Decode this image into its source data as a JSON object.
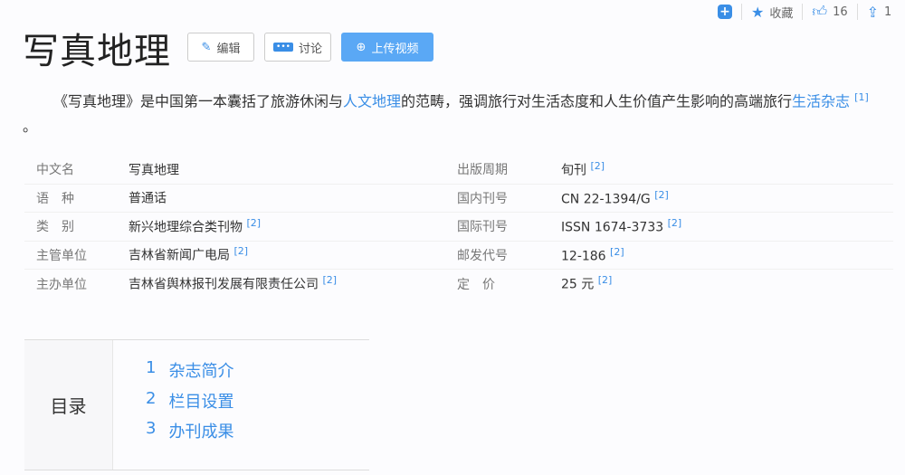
{
  "toolbar": {
    "collect": "收藏",
    "likes": "16",
    "share_count": "1"
  },
  "title": "写真地理",
  "buttons": {
    "edit": "编辑",
    "discuss": "讨论",
    "upload": "上传视频"
  },
  "intro": {
    "p1": "《写真地理》是中国第一本囊括了旅游休闲与",
    "link1": "人文地理",
    "p2": "的范畴，强调旅行对生活态度和人生价值产生影响的高端旅行",
    "link2": "生活杂志",
    "ref": "[1]",
    "end": " 。"
  },
  "info": [
    {
      "l": "中文名",
      "v": "写真地理",
      "r": "",
      "l2": "出版周期",
      "v2": "旬刊",
      "r2": "[2]"
    },
    {
      "l": "语　种",
      "v": "普通话",
      "r": "",
      "l2": "国内刊号",
      "v2": "CN 22-1394/G",
      "r2": "[2]"
    },
    {
      "l": "类　别",
      "v": "新兴地理综合类刊物",
      "r": "[2]",
      "l2": "国际刊号",
      "v2": "ISSN 1674-3733",
      "r2": "[2]"
    },
    {
      "l": "主管单位",
      "v": "吉林省新闻广电局",
      "r": "[2]",
      "l2": "邮发代号",
      "v2": "12-186",
      "r2": "[2]"
    },
    {
      "l": "主办单位",
      "v": "吉林省舆林报刊发展有限责任公司",
      "r": "[2]",
      "l2": "定　价",
      "v2": "25 元",
      "r2": "[2]"
    }
  ],
  "toc": {
    "label": "目录",
    "items": [
      {
        "n": "1",
        "t": "杂志简介"
      },
      {
        "n": "2",
        "t": "栏目设置"
      },
      {
        "n": "3",
        "t": "办刊成果"
      }
    ]
  }
}
